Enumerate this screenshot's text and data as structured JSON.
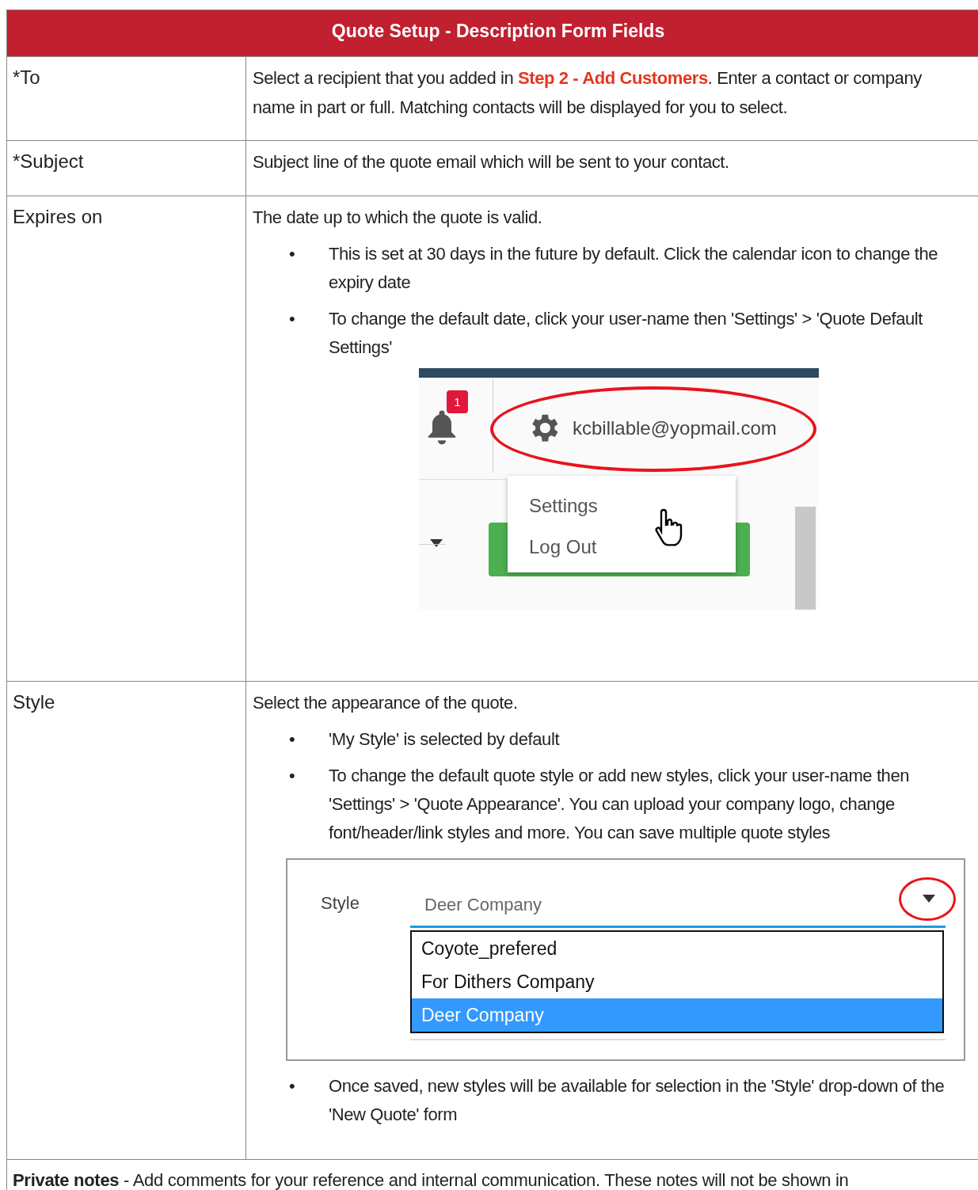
{
  "title": "Quote Setup - Description Form Fields",
  "bullet_mark": "•",
  "rows": [
    {
      "field": "*To",
      "blocks": [
        {
          "kind": "text",
          "text": "Select a recipient that you added in **Step 2 - Add Customers**. Enter a contact or company name in part or full. Matching contacts will be displayed for you to select."
        }
      ]
    },
    {
      "field": "*Subject",
      "blocks": [
        {
          "kind": "text",
          "text": "Subject line of the quote email which will be sent to your contact."
        }
      ]
    },
    {
      "field": "Expires on",
      "blocks": [
        {
          "kind": "text",
          "text": "The date up to which the quote is valid."
        },
        {
          "kind": "bullet",
          "text": "This is set at 30 days in the future by default. Click the calendar icon to change the expiry date"
        },
        {
          "kind": "bullet",
          "text": "To change the default date, click your user-name then 'Settings' > 'Quote Default Settings'"
        },
        {
          "kind": "account_menu",
          "badge": "1",
          "email": "kcbillable@yopmail.com",
          "items": [
            "Settings",
            "Log Out"
          ]
        }
      ]
    },
    {
      "field": "Style",
      "blocks": [
        {
          "kind": "text",
          "text": "Select the appearance of the quote."
        },
        {
          "kind": "bullet",
          "text": "'My Style' is selected by default"
        },
        {
          "kind": "bullet",
          "text": "To change the default quote style or add new styles, click your user-name then 'Settings' > 'Quote Appearance'. You can upload your company logo, change font/header/link styles and more. You can save multiple quote styles"
        },
        {
          "kind": "style_select",
          "label": "Style",
          "value": "Deer Company",
          "options": [
            {
              "label": "Coyote_prefered",
              "selected": false
            },
            {
              "label": "For Dithers Company",
              "selected": false
            },
            {
              "label": "Deer Company",
              "selected": true
            }
          ]
        },
        {
          "kind": "bullet",
          "text": "Once saved, new styles will be available for selection in the 'Style' drop-down of the 'New Quote' form"
        }
      ]
    }
  ],
  "footer_note": "**Private notes** - Add comments for your reference and internal communication. These notes will not be shown in"
}
